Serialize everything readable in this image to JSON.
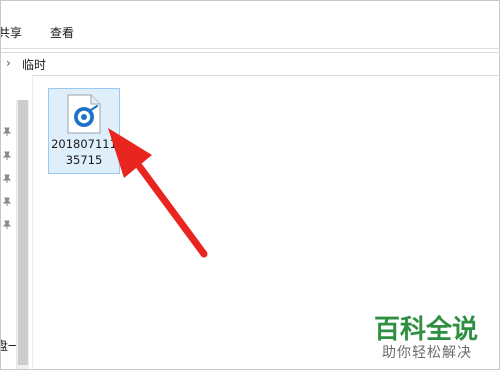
{
  "ribbon": {
    "tabs": [
      "共享",
      "查看"
    ],
    "share_label": "共享",
    "view_label": "查看"
  },
  "address_bar": {
    "chevron": "›",
    "crumb": "临时"
  },
  "nav_pane": {
    "fragment_text": "盘一",
    "pinned_icon": "pin-icon"
  },
  "file": {
    "name": "20180711135715",
    "icon": "audio-file-icon",
    "selected": true
  },
  "annotation": {
    "color": "#e8251f",
    "icon": "arrow-annotation"
  },
  "watermark": {
    "logo": "百科全说",
    "slogan": "助你轻松解决",
    "logo_color": "#2f8f41"
  }
}
